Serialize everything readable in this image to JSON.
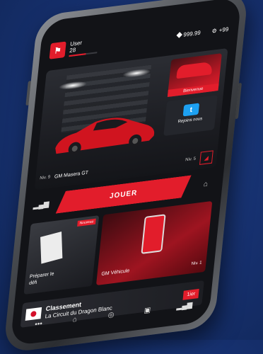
{
  "header": {
    "user_label": "User",
    "user_level": "28",
    "coins": "999.99",
    "credits": "+99",
    "xp_fraction": 0.6
  },
  "hero": {
    "bienvenue_label": "Bienvenue",
    "rejoins_label": "Rejoins nous",
    "car_level_left": "Niv. 9",
    "car_name": "GM  Masera GT",
    "car_level_right": "Niv. 5"
  },
  "play": {
    "jouer_label": "JOUER"
  },
  "cards": {
    "nouveau_badge": "Nouveau",
    "defi_line1": "Préparer le",
    "defi_line2": "défi",
    "vehicule_label": "GM Véhicule",
    "vehicule_level": "Niv. 1"
  },
  "classement": {
    "title": "Classement",
    "subtitle": "La Circuit du Dragon Blanc",
    "rank": "1ier"
  },
  "colors": {
    "accent": "#e21d2b",
    "background": "#16306e",
    "screen": "#121317"
  },
  "icons": {
    "logo": "flag-icon",
    "coin": "diamond-icon",
    "credits": "gear-icon",
    "stats": "bar-chart-icon",
    "garage": "garage-icon",
    "home": "home-icon",
    "currency": "currency-icon",
    "shop": "shop-icon",
    "more": "more-icon"
  }
}
